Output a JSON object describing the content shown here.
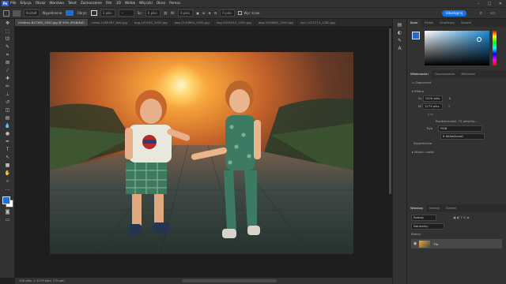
{
  "app": {
    "logo": "Ps"
  },
  "menu": [
    "Plik",
    "Edycja",
    "Obraz",
    "Warstwa",
    "Tekst",
    "Zaznaczenie",
    "Filtr",
    "3D",
    "Widok",
    "Wtyczki",
    "Okno",
    "Pomoc"
  ],
  "window_controls": [
    "–",
    "□",
    "✕"
  ],
  "options": {
    "fill_label": "Kształt",
    "fill_stroke": "Wypełnienie:",
    "stroke_label": "Obrys:",
    "stroke_width": "3 piks.",
    "w_label": "Sz:",
    "w_value": "0 piks.",
    "h_label": "W:",
    "h_value": "0 piks.",
    "radius_value": "0 piks.",
    "align_edges": "Wyr. kraw.",
    "share_label": "Udostępnij"
  },
  "tabs": [
    "children-817365_1920.jpg @ 50% (RGB/8#)",
    "chess-1483387_640.jpg",
    "dog-247440_1920.jpg",
    "dog-2130694_1920.jpg",
    "dog-3249344_1920.jpg",
    "dog-3449881_1920.jpg",
    "eye-1471273_1280.jpg"
  ],
  "status": "100 piks. x 1279 piks. (72 ppi)",
  "panels": {
    "color_tabs": [
      "Kolor",
      "Próbki",
      "Gradienty",
      "Wzorki"
    ],
    "props_tabs": [
      "Właściwości",
      "Dopasowania",
      "Biblioteki"
    ],
    "doc_label": "Dokument",
    "canvas_section": "Płótno",
    "w_field": "1920 piks.",
    "h_field": "1279 piks.",
    "x_label": "X",
    "y_label": "Y",
    "resolution": "Rozdzielczość: 72 pikseli/c...",
    "mode_label": "Tryb",
    "mode_value": "RGB",
    "depth_value": "8 bitów/kanał",
    "bg_label": "Wypełnienie",
    "rulers_section": "Miarki i siatki",
    "layers_tabs": [
      "Warstwy",
      "Kanały",
      "Ścieżki"
    ],
    "layer_kind": "Rodzaj",
    "layer_mode": "Normalny",
    "layer_lock": "Blokuj:",
    "layer_name": "Tło"
  },
  "colors": {
    "accent": "#1473e6",
    "fg": "#1b6fd6",
    "bg": "#ffffff"
  }
}
